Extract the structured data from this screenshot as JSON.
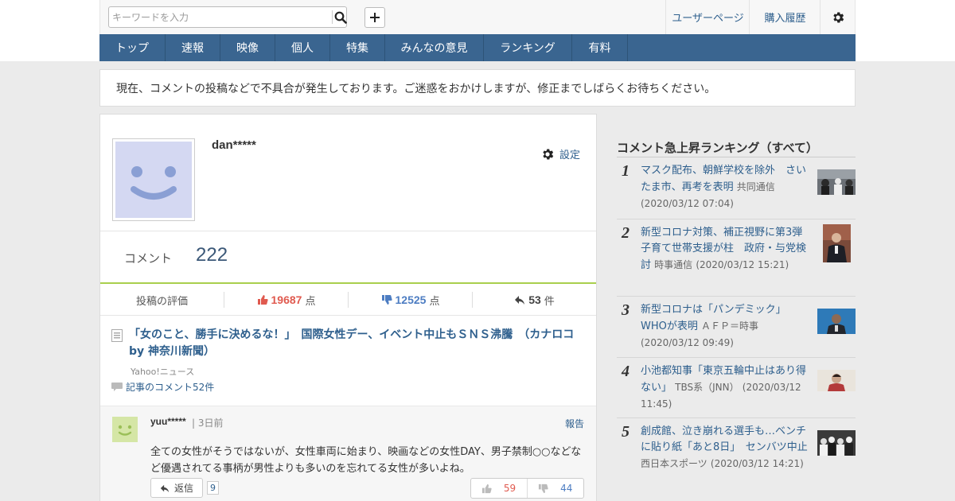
{
  "header": {
    "search_placeholder": "キーワードを入力",
    "user_page": "ユーザーページ",
    "purchase_history": "購入履歴"
  },
  "nav": {
    "items": [
      "トップ",
      "速報",
      "映像",
      "個人",
      "特集",
      "みんなの意見",
      "ランキング",
      "有料"
    ]
  },
  "notice": "現在、コメントの投稿などで不具合が発生しております。ご迷惑をおかけしますが、修正までしばらくお待ちください。",
  "profile": {
    "username": "dan*****",
    "settings_label": "設定",
    "comment_label": "コメント",
    "comment_count": "222",
    "eval_label": "投稿の評価",
    "good_count": "19687",
    "bad_count": "12525",
    "point_unit": "点",
    "reply_count": "53",
    "reply_unit": "件"
  },
  "article": {
    "title": "「女のこと、勝手に決めるな！」　国際女性デー、イベント中止もＳＮＳ沸騰　（カナロコ by 神奈川新聞）",
    "source": "Yahoo!ニュース",
    "comments_link": "記事のコメント52件"
  },
  "comment": {
    "user": "yuu*****",
    "time": "3日前",
    "report": "報告",
    "text": "全ての女性がそうではないが、女性車両に始まり、映画などの女性DAY、男子禁制○○などなど優遇されてる事柄が男性よりも多いのを忘れてる女性が多いよね。",
    "reply_label": "返信",
    "reply_count": "9",
    "good": "59",
    "bad": "44"
  },
  "sidebar": {
    "title": "コメント急上昇ランキング（すべて）",
    "items": [
      {
        "rank": "1",
        "title": "マスク配布、朝鮮学校を除外　さいたま市、再考を表明",
        "source": "共同通信",
        "date": "(2020/03/12 07:04)"
      },
      {
        "rank": "2",
        "title": "新型コロナ対策、補正視野に第3弾　子育て世帯支援が柱　政府・与党検討",
        "source": "時事通信",
        "date": "(2020/03/12 15:21)"
      },
      {
        "rank": "3",
        "title": "新型コロナは「パンデミック」 WHOが表明",
        "source": "ＡＦＰ＝時事",
        "date": "(2020/03/12 09:49)"
      },
      {
        "rank": "4",
        "title": "小池都知事「東京五輪中止はあり得ない」",
        "source": "TBS系（JNN）",
        "date": "(2020/03/12 11:45)"
      },
      {
        "rank": "5",
        "title": "創成館、泣き崩れる選手も…ベンチに貼り紙「あと8日」　センバツ中止",
        "source": "西日本スポーツ",
        "date": "(2020/03/12 14:21)"
      }
    ]
  },
  "colors": {
    "nav_bg": "#3a6590",
    "link": "#2e5f8d",
    "good": "#e05a4f",
    "bad": "#4d7dc2",
    "accent_line": "#a9cf4d"
  }
}
